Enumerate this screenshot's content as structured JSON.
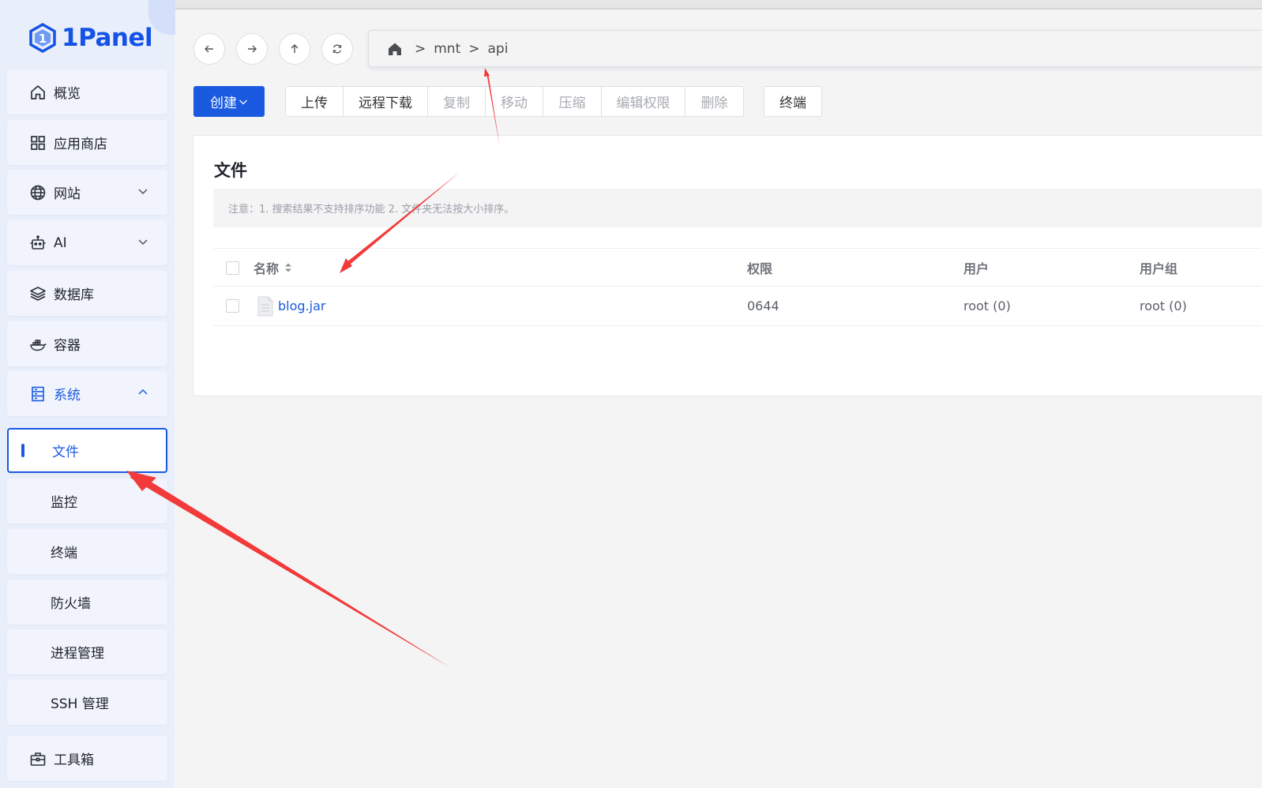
{
  "app": {
    "logo_text": "1Panel"
  },
  "sidebar": {
    "items": [
      {
        "label": "概览",
        "icon": "home-icon"
      },
      {
        "label": "应用商店",
        "icon": "grid-icon"
      },
      {
        "label": "网站",
        "icon": "globe-icon",
        "expandable": true
      },
      {
        "label": "AI",
        "icon": "robot-icon",
        "expandable": true
      },
      {
        "label": "数据库",
        "icon": "layers-icon"
      },
      {
        "label": "容器",
        "icon": "docker-icon"
      },
      {
        "label": "系统",
        "icon": "server-icon",
        "expanded": true
      },
      {
        "label": "文件",
        "sub": true,
        "selected": true
      },
      {
        "label": "监控",
        "sub": true
      },
      {
        "label": "终端",
        "sub": true
      },
      {
        "label": "防火墙",
        "sub": true
      },
      {
        "label": "进程管理",
        "sub": true
      },
      {
        "label": "SSH 管理",
        "sub": true
      },
      {
        "label": "工具箱",
        "icon": "toolbox-icon"
      }
    ]
  },
  "nav": {
    "back_icon": "arrow-left-icon",
    "forward_icon": "arrow-right-icon",
    "up_icon": "arrow-up-icon",
    "refresh_icon": "refresh-icon"
  },
  "breadcrumb": {
    "home_icon": "home-filled-icon",
    "separator": ">",
    "parts": [
      "mnt",
      "api"
    ]
  },
  "toolbar": {
    "create_label": "创建",
    "group": [
      {
        "label": "上传",
        "disabled": false
      },
      {
        "label": "远程下载",
        "disabled": false
      },
      {
        "label": "复制",
        "disabled": true
      },
      {
        "label": "移动",
        "disabled": true
      },
      {
        "label": "压缩",
        "disabled": true
      },
      {
        "label": "编辑权限",
        "disabled": true
      },
      {
        "label": "删除",
        "disabled": true
      }
    ],
    "terminal_label": "终端"
  },
  "files": {
    "title": "文件",
    "notice": "注意：1. 搜索结果不支持排序功能 2. 文件夹无法按大小排序。",
    "columns": {
      "name": "名称",
      "permission": "权限",
      "user": "用户",
      "group": "用户组"
    },
    "rows": [
      {
        "name": "blog.jar",
        "permission": "0644",
        "user": "root (0)",
        "group": "root (0)"
      }
    ]
  },
  "colors": {
    "accent": "#1a5ae0",
    "annotation": "#f23a3a"
  }
}
